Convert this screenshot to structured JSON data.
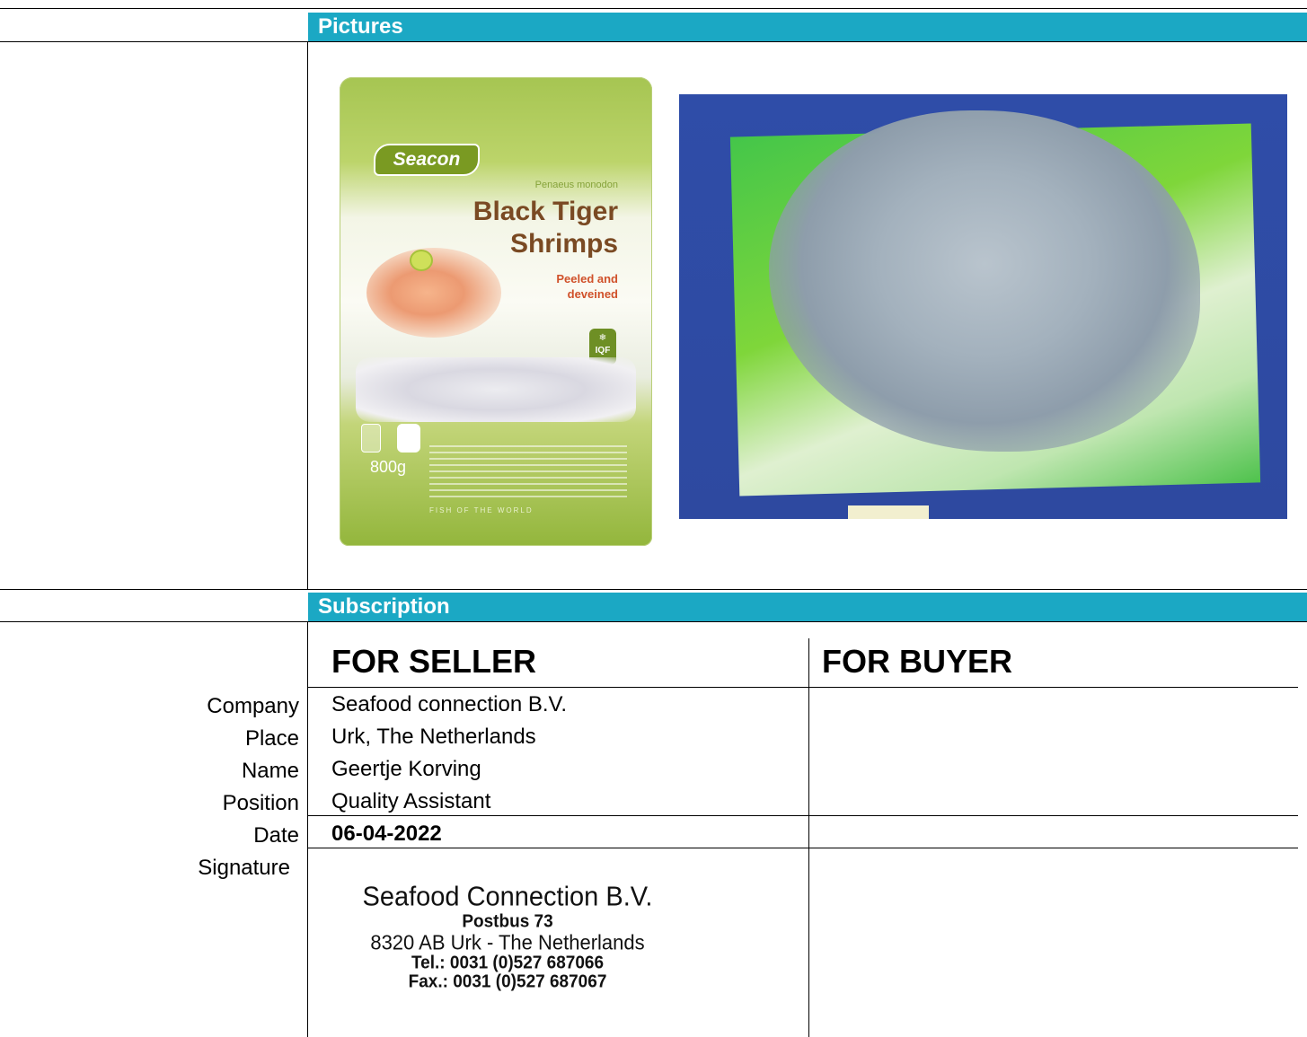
{
  "sections": {
    "pictures": "Pictures",
    "subscription": "Subscription"
  },
  "product_bag": {
    "brand": "Seacon",
    "latin_name": "Penaeus monodon",
    "title_line1": "Black Tiger",
    "title_line2": "Shrimps",
    "subtitle_line1": "Peeled and",
    "subtitle_line2": "deveined",
    "iqf": "IQF",
    "weight": "800g",
    "tagline": "FISH OF THE WORLD"
  },
  "subscription": {
    "seller_header": "FOR SELLER",
    "buyer_header": "FOR BUYER",
    "labels": {
      "company": "Company",
      "place": "Place",
      "name": "Name",
      "position": "Position",
      "date": "Date",
      "signature": "Signature"
    },
    "seller": {
      "company": "Seafood connection B.V.",
      "place": "Urk, The Netherlands",
      "name": "Geertje Korving",
      "position": "Quality Assistant",
      "date": "06-04-2022"
    },
    "stamp": {
      "line1": "Seafood Connection B.V.",
      "line2": "Postbus 73",
      "line3": "8320 AB Urk - The Netherlands",
      "line4": "Tel.: 0031 (0)527 687066",
      "line5": "Fax.: 0031 (0)527 687067"
    }
  }
}
